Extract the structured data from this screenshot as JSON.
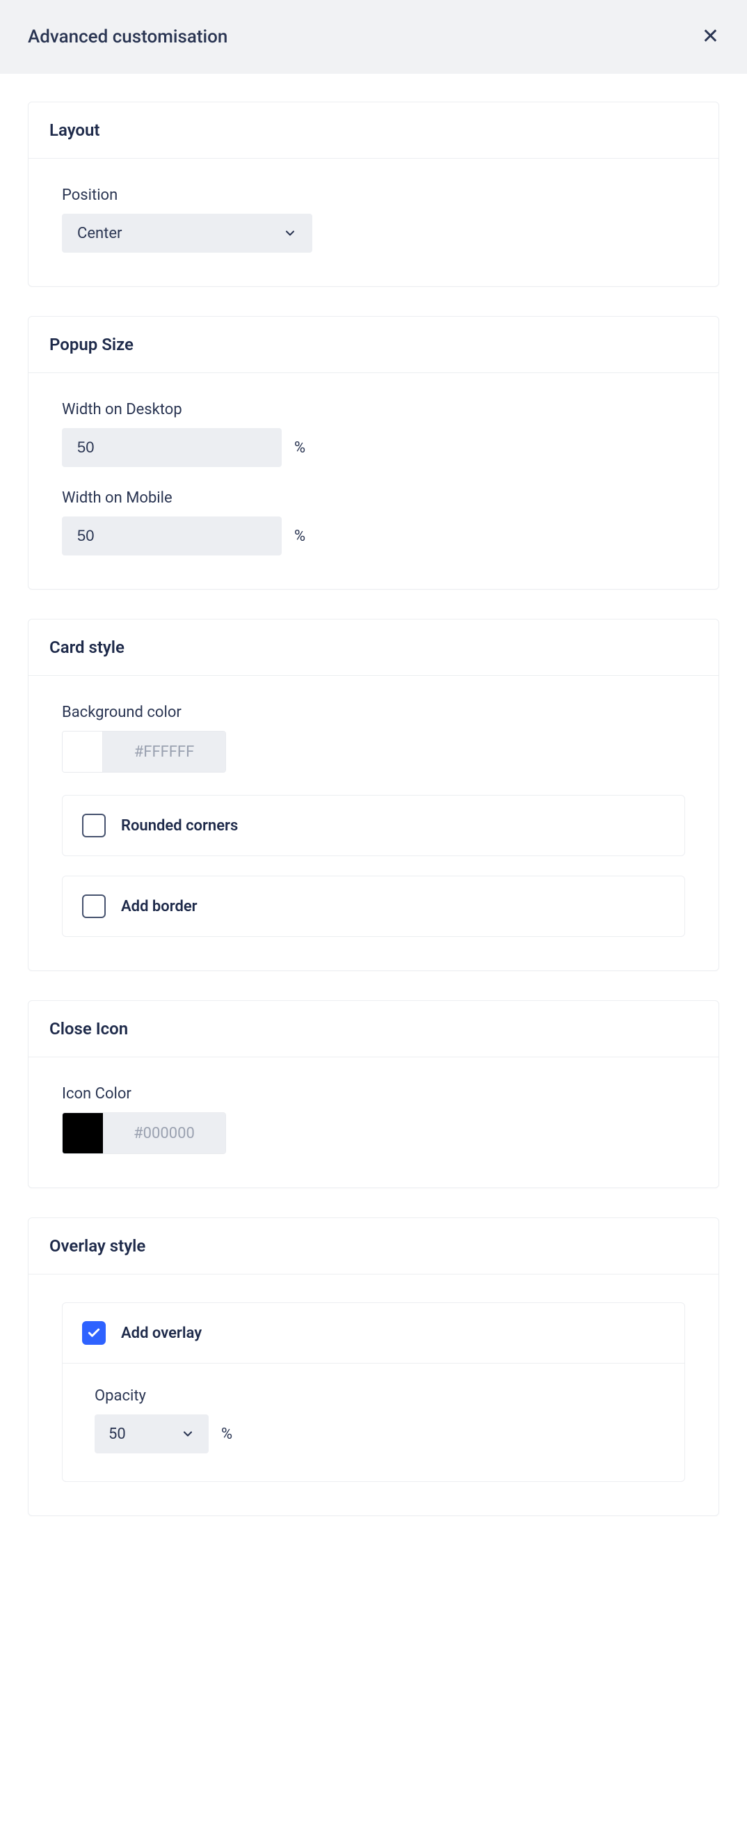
{
  "header": {
    "title": "Advanced customisation"
  },
  "layout": {
    "title": "Layout",
    "position_label": "Position",
    "position_value": "Center"
  },
  "popup": {
    "title": "Popup Size",
    "desktop_label": "Width on Desktop",
    "desktop_value": "50",
    "mobile_label": "Width on Mobile",
    "mobile_value": "50",
    "unit": "%"
  },
  "cardstyle": {
    "title": "Card style",
    "bg_label": "Background color",
    "bg_value": "#FFFFFF",
    "rounded_label": "Rounded corners",
    "border_label": "Add border"
  },
  "closeicon": {
    "title": "Close Icon",
    "color_label": "Icon Color",
    "color_value": "#000000"
  },
  "overlay": {
    "title": "Overlay style",
    "add_label": "Add overlay",
    "opacity_label": "Opacity",
    "opacity_value": "50",
    "unit": "%"
  }
}
